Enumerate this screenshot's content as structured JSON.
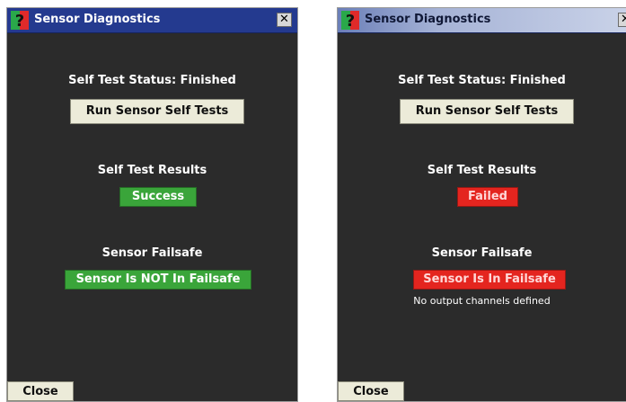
{
  "colors": {
    "success": "#3aa53a",
    "failed": "#e4251f",
    "panel_bg": "#2b2b2b",
    "title_active": "#243a8f"
  },
  "left_window": {
    "title": "Sensor Diagnostics",
    "status_label": "Self Test Status:  Finished",
    "run_button": "Run Sensor Self Tests",
    "results_heading": "Self Test Results",
    "results_value": "Success",
    "failsafe_heading": "Sensor Failsafe",
    "failsafe_value": "Sensor Is NOT In Failsafe",
    "close_button": "Close"
  },
  "right_window": {
    "title": "Sensor Diagnostics",
    "status_label": "Self Test Status:  Finished",
    "run_button": "Run Sensor Self Tests",
    "results_heading": "Self Test Results",
    "results_value": "Failed",
    "failsafe_heading": "Sensor Failsafe",
    "failsafe_value": "Sensor Is In Failsafe",
    "note": "No output channels defined",
    "close_button": "Close"
  },
  "icons": {
    "app": "question-mark-icon",
    "close": "close-icon"
  }
}
